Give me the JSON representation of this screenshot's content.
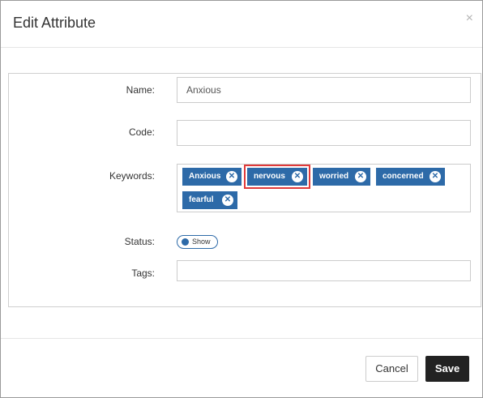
{
  "dialog": {
    "title": "Edit Attribute",
    "close_label": "×"
  },
  "form": {
    "name_label": "Name:",
    "name_value": "Anxious",
    "code_label": "Code:",
    "code_value": "",
    "keywords_label": "Keywords:",
    "keywords": [
      "Anxious",
      "nervous",
      "worried",
      "concerned",
      "fearful"
    ],
    "keyword_remove_glyph": "✕",
    "status_label": "Status:",
    "status_value": "Show",
    "tags_label": "Tags:",
    "tags_value": ""
  },
  "footer": {
    "cancel_label": "Cancel",
    "save_label": "Save"
  },
  "colors": {
    "accent": "#2d6aa8",
    "highlight": "#e03a3a",
    "save_bg": "#222222"
  },
  "highlighted_keyword": "nervous"
}
